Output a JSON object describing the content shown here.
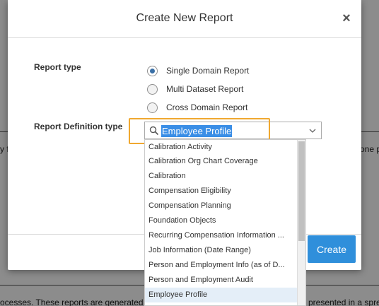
{
  "background": {
    "left_fragment": "y f",
    "right_fragment": "one p",
    "bottom_left": "ocesses. These reports are generated b",
    "bottom_right": "presented in a spre"
  },
  "dialog": {
    "title": "Create New Report",
    "close_glyph": "×",
    "report_type_label": "Report type",
    "report_types": [
      {
        "label": "Single Domain Report",
        "checked": true
      },
      {
        "label": "Multi Dataset Report",
        "checked": false
      },
      {
        "label": "Cross Domain Report",
        "checked": false
      }
    ],
    "definition_type_label": "Report Definition type",
    "combo": {
      "value": "Employee Profile",
      "search_icon": "search-icon",
      "chevron_icon": "chevron-down-icon"
    },
    "dropdown_items": [
      "Calibration Activity",
      "Calibration Org Chart Coverage",
      "Calibration",
      "Compensation Eligibility",
      "Compensation Planning",
      "Foundation Objects",
      "Recurring Compensation Information ...",
      "Job Information (Date Range)",
      "Person and Employment Info (as of D...",
      "Person and Employment Audit",
      "Employee Profile"
    ],
    "selected_item": "Employee Profile",
    "create_label": "Create"
  },
  "colors": {
    "accent": "#2f8fdb",
    "highlight_border": "#f0a830",
    "selection": "#3a8ee6"
  }
}
